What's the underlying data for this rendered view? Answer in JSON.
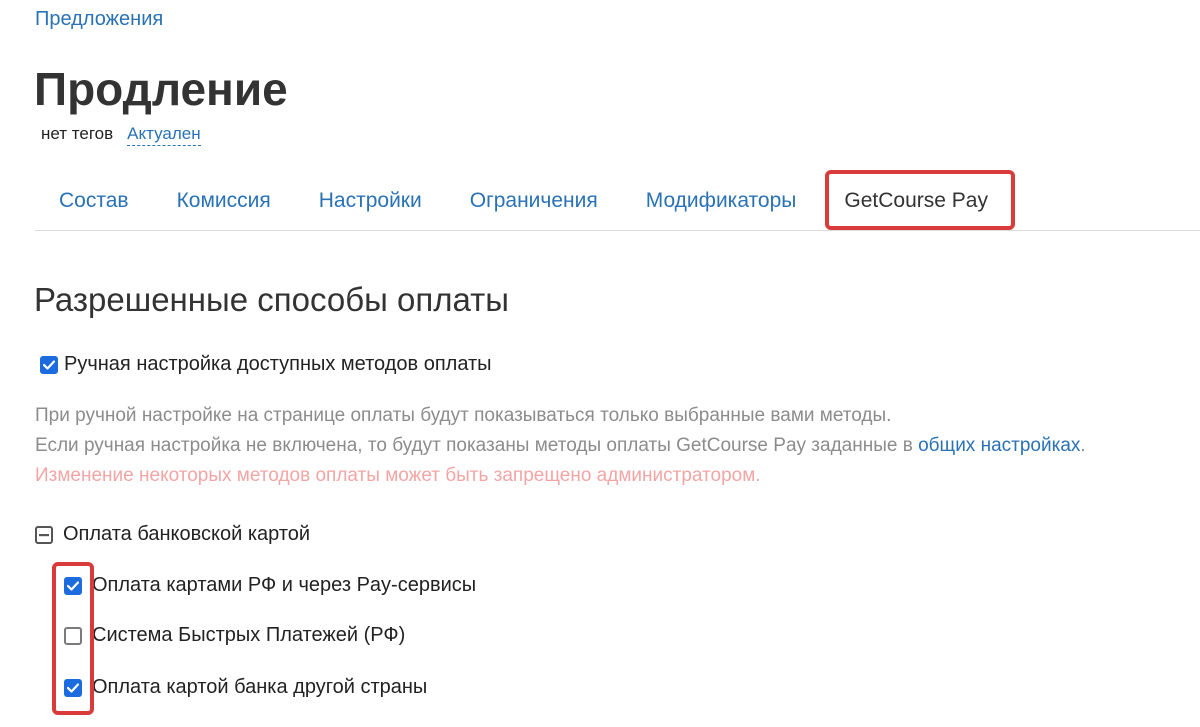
{
  "breadcrumb": "Предложения",
  "title": "Продление",
  "tags_text": "нет тегов",
  "status_link": "Актуален",
  "tabs": [
    {
      "label": "Состав"
    },
    {
      "label": "Комиссия"
    },
    {
      "label": "Настройки"
    },
    {
      "label": "Ограничения"
    },
    {
      "label": "Модификаторы"
    },
    {
      "label": "GetCourse Pay"
    }
  ],
  "active_tab": "GetCourse Pay",
  "section_title": "Разрешенные способы оплаты",
  "manual_setting": {
    "label": "Ручная настройка доступных методов оплаты",
    "checked": true
  },
  "hint": {
    "line1": "При ручной настройке на странице оплаты будут показываться только выбранные вами методы.",
    "line2_prefix": "Если ручная настройка не включена, то будут показаны методы оплаты GetCourse Pay заданные в",
    "line2_link": "общих настройках",
    "line2_suffix": ".",
    "warning": "Изменение некоторых методов оплаты может быть запрещено администратором."
  },
  "group": {
    "label": "Оплата банковской картой",
    "state": "partial",
    "options": [
      {
        "label": "Оплата картами РФ и через Pay-сервисы",
        "checked": true
      },
      {
        "label": "Система Быстрых Платежей (РФ)",
        "checked": false
      },
      {
        "label": "Оплата картой банка другой страны",
        "checked": true
      }
    ]
  },
  "colors": {
    "link": "#2a72b5",
    "checkbox_checked": "#1c6ce0",
    "highlight_border": "#d93a3a",
    "warning_text": "#f3a5a5",
    "hint_text": "#8c8c8c"
  }
}
